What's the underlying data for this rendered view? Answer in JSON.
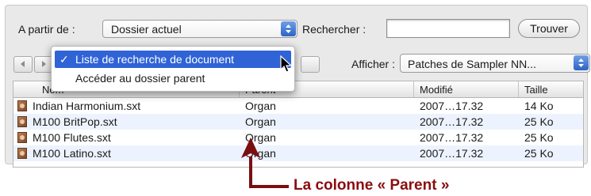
{
  "toolbar": {
    "from_label": "A partir de :",
    "from_value": "Dossier actuel",
    "search_label": "Rechercher :",
    "search_value": "",
    "find_button": "Trouver",
    "show_label": "Afficher :",
    "show_value": "Patches de Sampler NN..."
  },
  "menu": {
    "items": [
      {
        "label": "Liste de recherche de document",
        "checked": true,
        "check": "✓"
      },
      {
        "label": "Accéder au dossier parent",
        "checked": false
      }
    ]
  },
  "table": {
    "headers": {
      "name": "Nom",
      "parent": "Parent",
      "modified": "Modifié",
      "size": "Taille"
    },
    "rows": [
      {
        "name": "Indian Harmonium.sxt",
        "parent": "Organ",
        "modified": "2007…17.32",
        "size": "14 Ko"
      },
      {
        "name": "M100 BritPop.sxt",
        "parent": "Organ",
        "modified": "2007…17.32",
        "size": "25 Ko"
      },
      {
        "name": "M100 Flutes.sxt",
        "parent": "Organ",
        "modified": "2007…17.32",
        "size": "25 Ko"
      },
      {
        "name": "M100 Latino.sxt",
        "parent": "Organ",
        "modified": "2007…17.32",
        "size": "25 Ko"
      }
    ]
  },
  "annotation": {
    "text": "La colonne « Parent »",
    "color": "#8a0d10"
  },
  "colors": {
    "accent": "#2f63d6",
    "row_alt": "#edf3fe"
  },
  "icons": [
    "chevron-updown-icon",
    "back-arrow-icon",
    "forward-arrow-icon",
    "file-icon",
    "pointer-cursor-icon"
  ]
}
